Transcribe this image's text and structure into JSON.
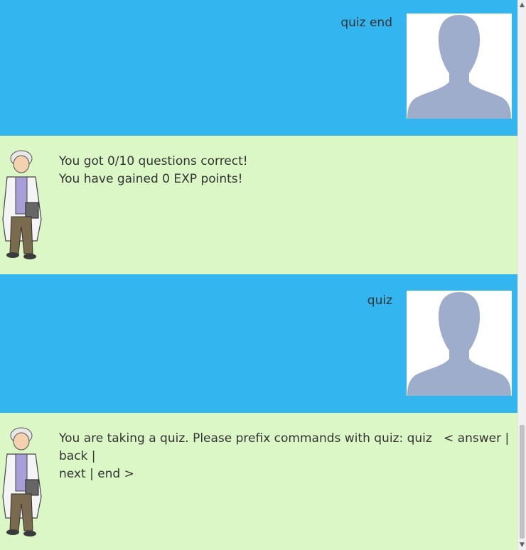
{
  "messages": [
    {
      "role": "user",
      "text": "quiz end"
    },
    {
      "role": "bot",
      "lines": [
        "You got 0/10 questions correct!",
        "You have gained 0 EXP points!"
      ]
    },
    {
      "role": "user",
      "text": "quiz"
    },
    {
      "role": "bot",
      "lines": [
        "You are taking a quiz. Please prefix commands with quiz: quiz   < answer | back |",
        "next | end >"
      ]
    }
  ],
  "colors": {
    "user_bubble": "#33b5f0",
    "bot_bubble": "#dcf7c6",
    "avatar_silhouette": "#9eadcc"
  },
  "icons": {
    "user_avatar": "person-silhouette-icon",
    "bot_avatar": "professor-sprite-icon",
    "scroll_up": "chevron-up-icon",
    "scroll_down": "chevron-down-icon"
  }
}
